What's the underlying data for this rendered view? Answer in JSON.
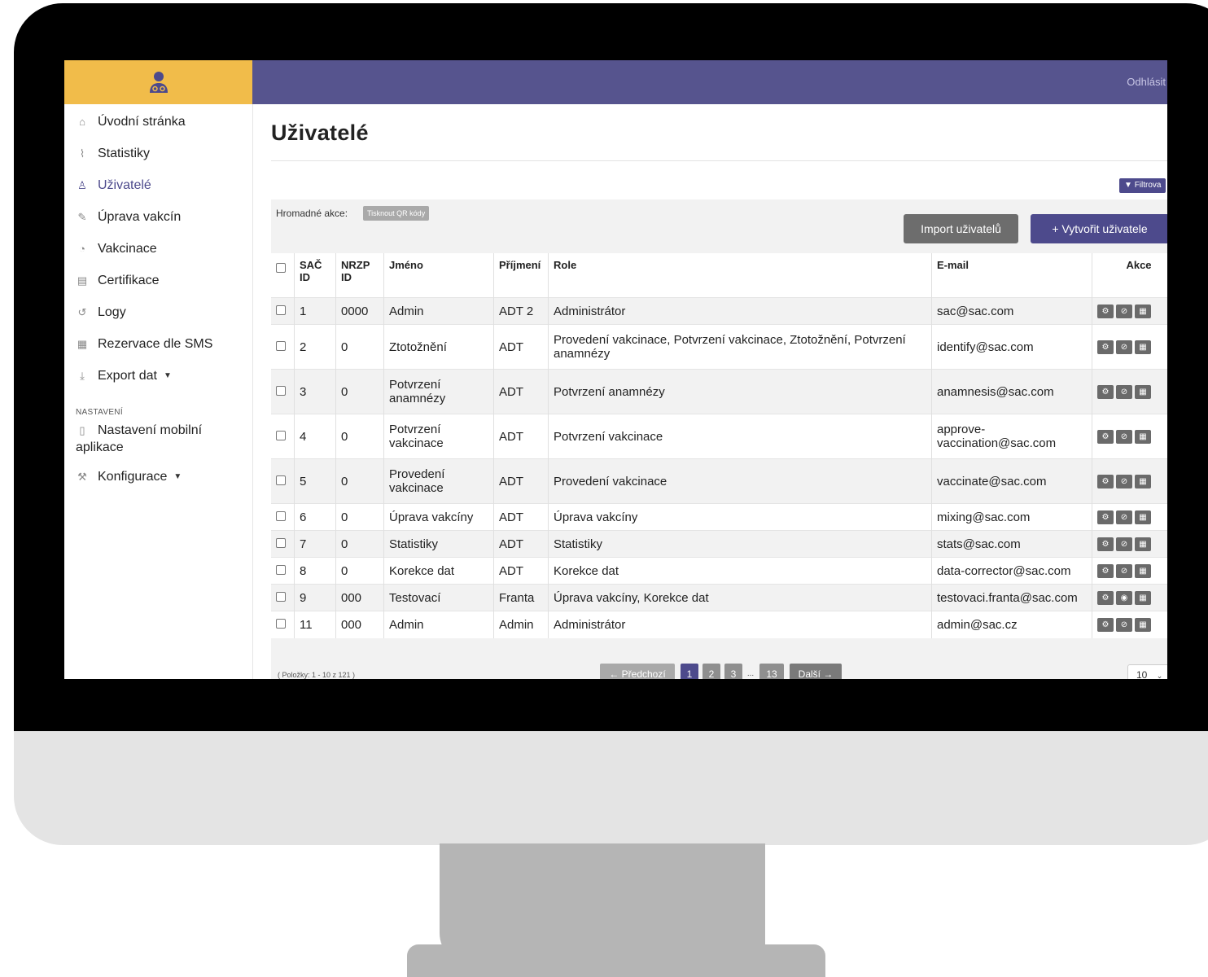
{
  "topbar": {
    "logout_label": "Odhlásit"
  },
  "sidebar": {
    "items": [
      {
        "label": "Úvodní stránka",
        "icon": "home-icon",
        "glyph": "⌂"
      },
      {
        "label": "Statistiky",
        "icon": "chart-icon",
        "glyph": "⌇"
      },
      {
        "label": "Uživatelé",
        "icon": "users-icon",
        "glyph": "♙"
      },
      {
        "label": "Úprava vakcín",
        "icon": "pen-icon",
        "glyph": "✎"
      },
      {
        "label": "Vakcinace",
        "icon": "user-circle-icon",
        "glyph": "◔"
      },
      {
        "label": "Certifikace",
        "icon": "certificate-icon",
        "glyph": "▤"
      },
      {
        "label": "Logy",
        "icon": "history-icon",
        "glyph": "↺"
      },
      {
        "label": "Rezervace dle SMS",
        "icon": "calendar-icon",
        "glyph": "▦"
      },
      {
        "label": "Export dat",
        "icon": "download-icon",
        "glyph": "⤓"
      }
    ],
    "section_label": "NASTAVENÍ",
    "settings_items": [
      {
        "label_line1": "Nastavení mobilní",
        "label_line2": "aplikace",
        "icon": "mobile-icon",
        "glyph": "▯"
      },
      {
        "label": "Konfigurace",
        "icon": "wrench-icon",
        "glyph": "⚒"
      }
    ]
  },
  "main": {
    "title": "Uživatelé",
    "filter_label": "Filtrova",
    "bulk_label": "Hromadné akce:",
    "print_qr_label": "Tisknout QR kódy",
    "import_label": "Import uživatelů",
    "create_label": "+ Vytvořit uživatele"
  },
  "table": {
    "headers": {
      "sac_id_1": "SAČ",
      "sac_id_2": "ID",
      "nrzp_id_1": "NRZP",
      "nrzp_id_2": "ID",
      "name": "Jméno",
      "surname": "Příjmení",
      "role": "Role",
      "email": "E-mail",
      "actions": "Akce"
    },
    "rows": [
      {
        "sac": "1",
        "nrzp": "0000",
        "name": "Admin",
        "surname": "ADT 2",
        "role": "Administrátor",
        "email": "sac@sac.com"
      },
      {
        "sac": "2",
        "nrzp": "0",
        "name": "Ztotožnění",
        "surname": "ADT",
        "role": "Provedení vakcinace, Potvrzení vakcinace, Ztotožnění, Potvrzení anamnézy",
        "email": "identify@sac.com"
      },
      {
        "sac": "3",
        "nrzp": "0",
        "name": "Potvrzení anamnézy",
        "surname": "ADT",
        "role": "Potvrzení anamnézy",
        "email": "anamnesis@sac.com"
      },
      {
        "sac": "4",
        "nrzp": "0",
        "name": "Potvrzení vakcinace",
        "surname": "ADT",
        "role": "Potvrzení vakcinace",
        "email": "approve-vaccination@sac.com"
      },
      {
        "sac": "5",
        "nrzp": "0",
        "name": "Provedení vakcinace",
        "surname": "ADT",
        "role": "Provedení vakcinace",
        "email": "vaccinate@sac.com"
      },
      {
        "sac": "6",
        "nrzp": "0",
        "name": "Úprava vakcíny",
        "surname": "ADT",
        "role": "Úprava vakcíny",
        "email": "mixing@sac.com"
      },
      {
        "sac": "7",
        "nrzp": "0",
        "name": "Statistiky",
        "surname": "ADT",
        "role": "Statistiky",
        "email": "stats@sac.com"
      },
      {
        "sac": "8",
        "nrzp": "0",
        "name": "Korekce dat",
        "surname": "ADT",
        "role": "Korekce dat",
        "email": "data-corrector@sac.com"
      },
      {
        "sac": "9",
        "nrzp": "000",
        "name": "Testovací",
        "surname": "Franta",
        "role": "Úprava vakcíny, Korekce dat",
        "email": "testovaci.franta@sac.com"
      },
      {
        "sac": "11",
        "nrzp": "000",
        "name": "Admin",
        "surname": "Admin",
        "role": "Administrátor",
        "email": "admin@sac.cz"
      }
    ]
  },
  "pagination": {
    "info": "( Položky: 1 - 10 z 121 )",
    "prev": "← Předchozí",
    "pages": [
      "1",
      "2",
      "3"
    ],
    "dots": "...",
    "last": "13",
    "next": "Další →",
    "per_page": "10"
  }
}
